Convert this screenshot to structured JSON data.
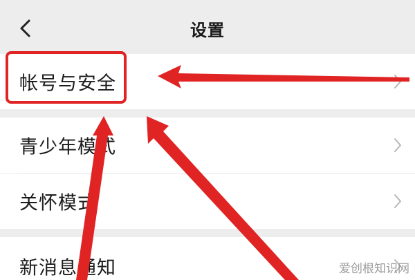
{
  "header": {
    "back_icon": "chevron-left-icon",
    "title": "设置"
  },
  "settings": {
    "items": [
      {
        "label": "帐号与安全",
        "icon": "chevron-right-icon"
      },
      {
        "label": "青少年模式",
        "icon": "chevron-right-icon"
      },
      {
        "label": "关怀模式",
        "icon": "chevron-right-icon"
      },
      {
        "label": "新消息通知",
        "icon": "chevron-right-icon"
      }
    ]
  },
  "annotation": {
    "highlight_color": "#e02424",
    "arrow_color": "#e02424"
  },
  "watermark": {
    "text": "爱创根知识网"
  }
}
